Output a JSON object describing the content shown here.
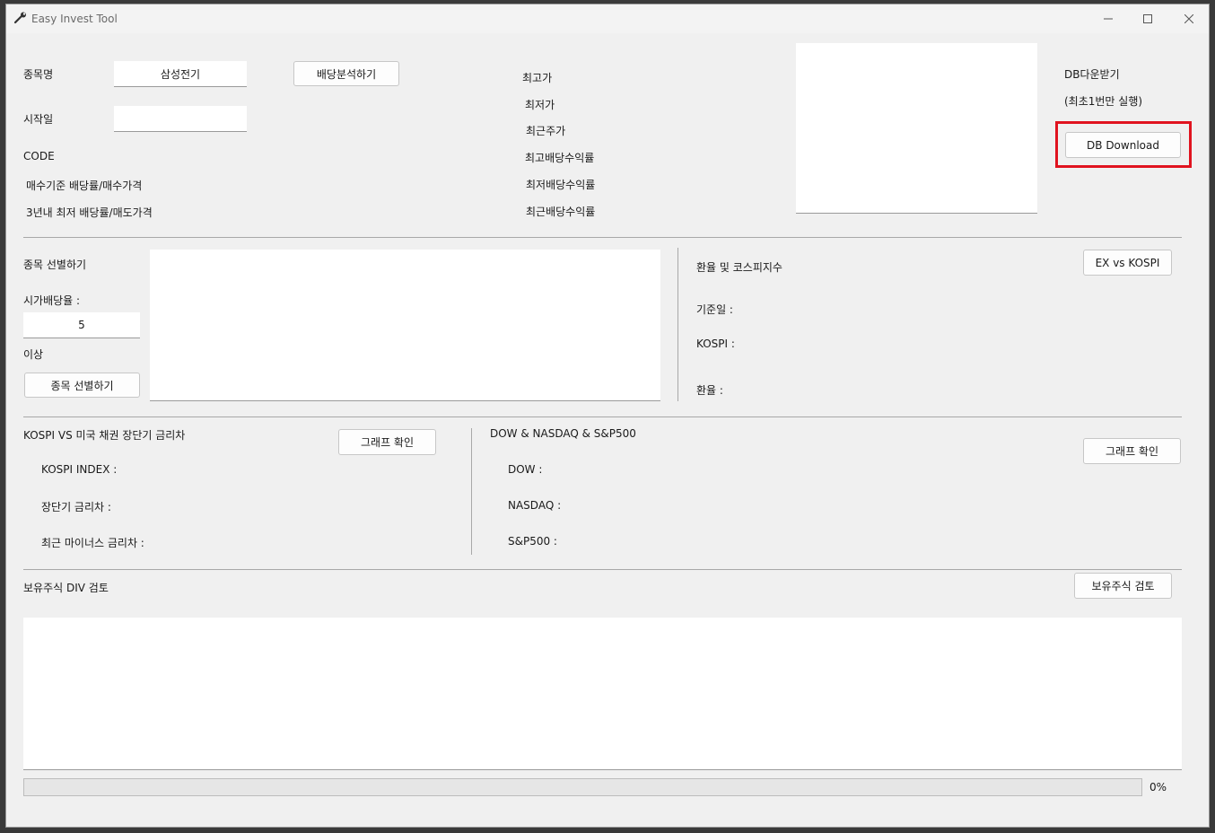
{
  "window": {
    "title": "Easy Invest Tool"
  },
  "stock_section": {
    "name_label": "종목명",
    "name_value": "삼성전기",
    "analyze_button": "배당분석하기",
    "start_label": "시작일",
    "start_value": "",
    "code_label": "CODE",
    "buy_label": "매수기준 배당률/매수가격",
    "min3y_label": "3년내 최저 배당률/매도가격"
  },
  "price_stats": {
    "high_price": "최고가",
    "low_price": "최저가",
    "recent_price": "최근주가",
    "high_yield": "최고배당수익률",
    "low_yield": "최저배당수익률",
    "recent_yield": "최근배당수익률"
  },
  "db": {
    "label": "DB다운받기",
    "note": "(최초1번만 실행)",
    "button": "DB Download"
  },
  "screener": {
    "title": "종목 선별하기",
    "yield_label": "시가배당율 :",
    "yield_value": "5",
    "above_label": "이상",
    "button": "종목 선별하기"
  },
  "fx": {
    "title": "환율 및 코스피지수",
    "button": "EX vs KOSPI",
    "base_date": "기준일 :",
    "kospi": "KOSPI :",
    "rate": "환율 :"
  },
  "bond": {
    "title": "KOSPI VS 미국 채권 장단기 금리차",
    "button": "그래프 확인",
    "kospi_index": "KOSPI INDEX :",
    "spread": "장단기 금리차 :",
    "neg_spread": "최근 마이너스 금리차 :"
  },
  "us_index": {
    "title": "DOW & NASDAQ & S&P500",
    "button": "그래프 확인",
    "dow": "DOW :",
    "nasdaq": "NASDAQ :",
    "sp500": "S&P500 :"
  },
  "holdings": {
    "title": "보유주식 DIV 검토",
    "button": "보유주식 검토"
  },
  "progress": {
    "value": 0,
    "label": "0%"
  },
  "colors": {
    "highlight": "#e0131f",
    "window_bg": "#f0f0f0"
  },
  "icons": {
    "app": "wrench-icon",
    "minimize": "minimize-icon",
    "maximize": "maximize-icon",
    "close": "close-icon"
  }
}
